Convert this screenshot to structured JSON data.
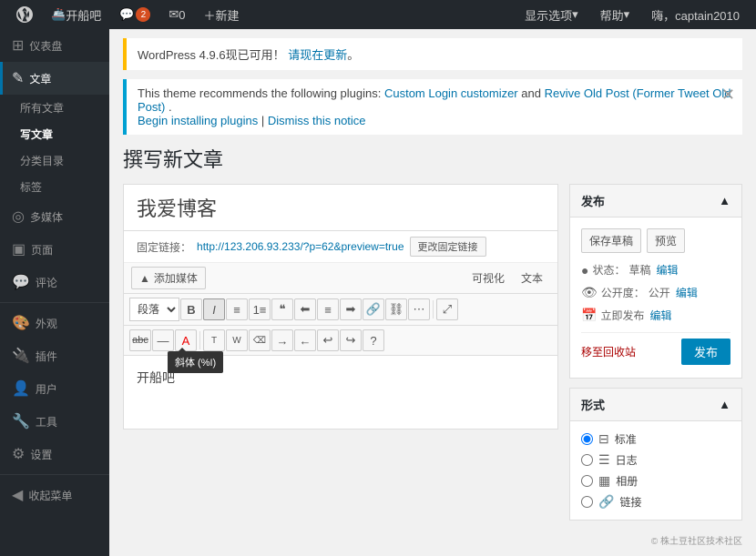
{
  "adminbar": {
    "site_name": "开船吧",
    "comments_count": "2",
    "messages_count": "0",
    "new_label": "新建",
    "display_options": "显示选项",
    "help": "帮助",
    "user": "嗨，captain2010"
  },
  "sidebar": {
    "items": [
      {
        "id": "dashboard",
        "label": "仪表盘",
        "icon": "⊞"
      },
      {
        "id": "posts",
        "label": "文章",
        "icon": "✎",
        "active": true
      },
      {
        "id": "media",
        "label": "多媒体",
        "icon": "◎"
      },
      {
        "id": "pages",
        "label": "页面",
        "icon": "▣"
      },
      {
        "id": "comments",
        "label": "评论",
        "icon": "💬"
      },
      {
        "id": "appearance",
        "label": "外观",
        "icon": "🎨"
      },
      {
        "id": "plugins",
        "label": "插件",
        "icon": "🔌"
      },
      {
        "id": "users",
        "label": "用户",
        "icon": "👤"
      },
      {
        "id": "tools",
        "label": "工具",
        "icon": "🔧"
      },
      {
        "id": "settings",
        "label": "设置",
        "icon": "⚙"
      },
      {
        "id": "collapse",
        "label": "收起菜单",
        "icon": "◀"
      }
    ],
    "submenu_posts": [
      {
        "label": "所有文章",
        "active": false
      },
      {
        "label": "写文章",
        "active": true
      },
      {
        "label": "分类目录",
        "active": false
      },
      {
        "label": "标签",
        "active": false
      }
    ]
  },
  "notices": {
    "update_text": "WordPress 4.9.6现已可用！",
    "update_link": "请现在更新",
    "plugin_text": "This theme recommends the following plugins: ",
    "plugin_link1": "Custom Login customizer",
    "plugin_and": " and ",
    "plugin_link2": "Revive Old Post (Former Tweet Old Post)",
    "plugin_end": ".",
    "install_link": "Begin installing plugins",
    "dismiss_link": "Dismiss this notice"
  },
  "editor": {
    "page_title": "撰写新文章",
    "post_title": "我爱博客",
    "permalink_label": "固定链接：",
    "permalink_url": "http://123.206.93.233/?p=62&preview=true",
    "change_permalink": "更改固定链接",
    "add_media": "添加媒体",
    "tab_visual": "可视化",
    "tab_text": "文本",
    "toolbar": {
      "format_select": "段落",
      "bold": "B",
      "italic": "I",
      "strikethrough": "S",
      "tooltip_italic": "斜体 (%I)"
    },
    "content": "开船吧"
  },
  "publish": {
    "box_title": "发布",
    "save_draft": "保存草稿",
    "preview": "预览",
    "status_label": "状态：",
    "status_value": "草稿",
    "status_edit": "编辑",
    "visibility_label": "公开度：",
    "visibility_value": "公开",
    "visibility_edit": "编辑",
    "publish_label": "立即发布",
    "publish_edit": "编辑",
    "move_to_trash": "移至回收站",
    "publish_btn": "发布"
  },
  "format": {
    "box_title": "形式",
    "options": [
      {
        "value": "standard",
        "label": "标准",
        "icon": "⊟",
        "checked": true
      },
      {
        "value": "aside",
        "label": "日志",
        "icon": "☰",
        "checked": false
      },
      {
        "value": "gallery",
        "label": "相册",
        "icon": "▦",
        "checked": false
      },
      {
        "value": "link",
        "label": "链接",
        "icon": "🔗",
        "checked": false
      }
    ]
  },
  "watermark": "© 株土豆社区技术社区"
}
